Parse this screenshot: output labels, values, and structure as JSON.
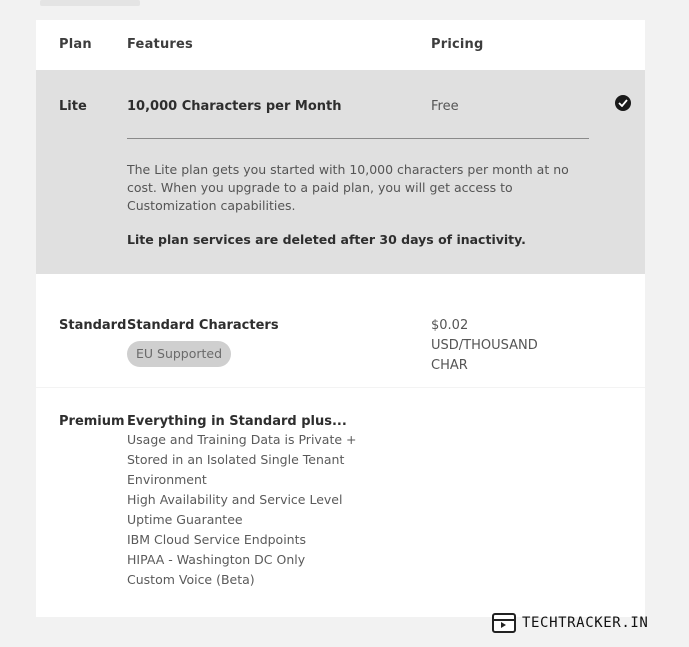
{
  "header": {
    "plan": "Plan",
    "features": "Features",
    "pricing": "Pricing"
  },
  "plans": {
    "lite": {
      "name": "Lite",
      "feature_title": "10,000 Characters per Month",
      "price": "Free",
      "selected": true,
      "description": "The Lite plan gets you started with 10,000 characters per month at no cost. When you upgrade to a paid plan, you will get access to Customization capabilities.",
      "note": "Lite plan services are deleted after 30 days of inactivity."
    },
    "standard": {
      "name": "Standard",
      "feature_title": "Standard Characters",
      "badge": "EU Supported",
      "price_lines": [
        "$0.02",
        "USD/THOUSAND",
        "CHAR"
      ]
    },
    "premium": {
      "name": "Premium",
      "feature_title": "Everything in Standard plus...",
      "features": [
        "Usage and Training Data is Private +",
        "Stored in an Isolated Single Tenant",
        "Environment",
        "High Availability and Service Level",
        "Uptime Guarantee",
        "IBM Cloud Service Endpoints",
        "HIPAA - Washington DC Only",
        "Custom Voice (Beta)"
      ]
    }
  },
  "watermark": {
    "text": "TECHTRACKER.IN"
  },
  "colors": {
    "selected_row_bg": "#e0e0e0",
    "badge_bg": "#cfcfcf",
    "page_bg": "#f2f2f2"
  }
}
